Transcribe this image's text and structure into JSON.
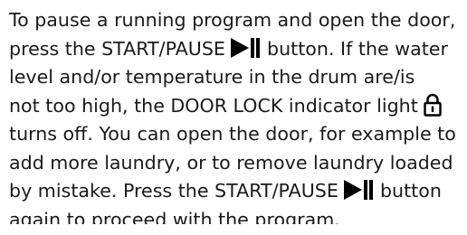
{
  "document": {
    "line_1": "To pause a running program and open the door,",
    "line_2a": "press the START/PAUSE",
    "line_2b": "button. If the water",
    "line_3": "level and/or temperature in the drum are/is",
    "line_4a": "not too high, the DOOR LOCK indicator light",
    "line_5": "turns off. You can open the door, for example to",
    "line_6": "add more laundry, or to remove laundry loaded",
    "line_7a": "by mistake. Press the START/PAUSE",
    "line_7b": "button",
    "line_8": "again to proceed with the program."
  },
  "icons": {
    "start_pause": "play-pause-icon",
    "door_lock": "padlock-icon"
  },
  "colors": {
    "text": "#1a1a1a",
    "icon": "#000000",
    "background": "#ffffff"
  }
}
